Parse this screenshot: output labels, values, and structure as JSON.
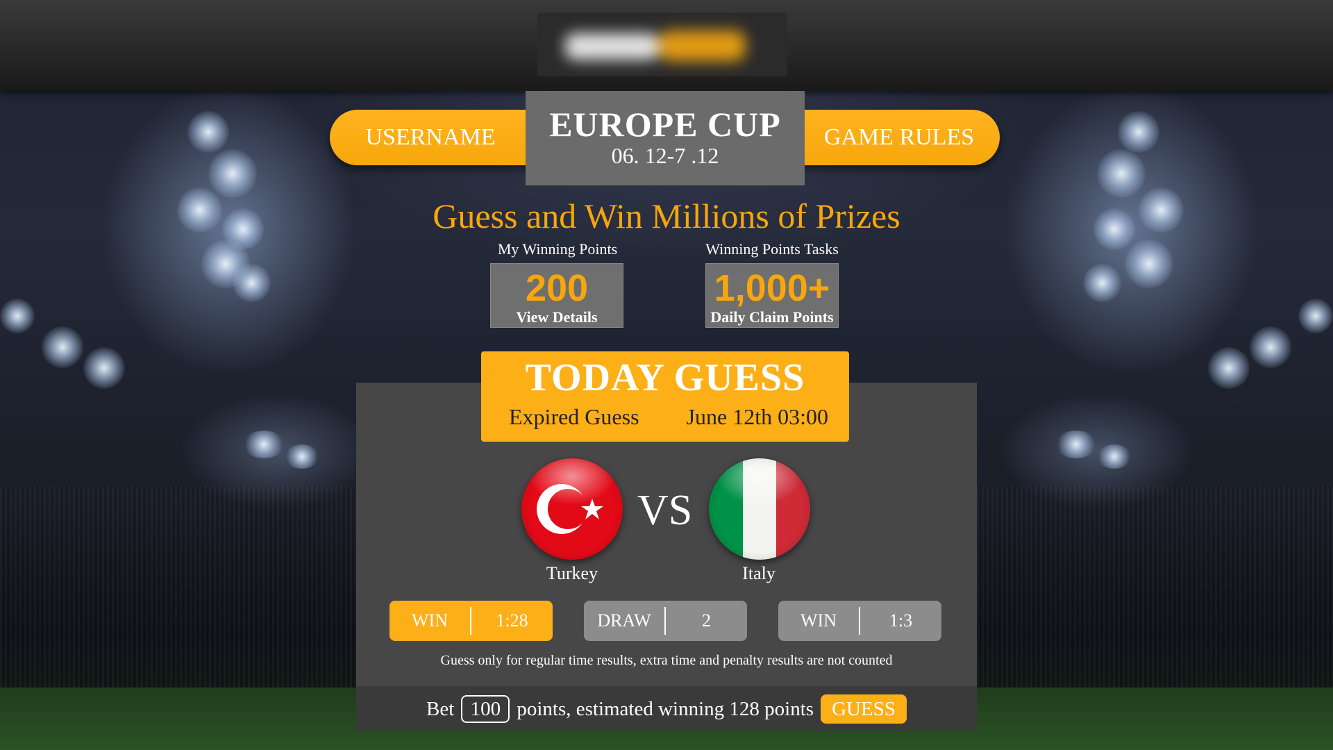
{
  "header": {
    "username_label": "USERNAME",
    "title": "EUROPE CUP",
    "dates": "06. 12-7 .12",
    "rules_label": "GAME RULES"
  },
  "headline": "Guess and Win Millions of Prizes",
  "points": {
    "my_label": "My Winning Points",
    "my_value": "200",
    "my_link": "View Details",
    "tasks_label": "Winning Points Tasks",
    "tasks_value": "1,000+",
    "tasks_link": "Daily Claim Points"
  },
  "today": {
    "title": "TODAY GUESS",
    "status": "Expired Guess",
    "time": "June 12th 03:00"
  },
  "match": {
    "home": "Turkey",
    "away": "Italy",
    "vs": "VS"
  },
  "odds": [
    {
      "label": "WIN",
      "value": "1:28",
      "state": "active"
    },
    {
      "label": "DRAW",
      "value": "2",
      "state": "inactive"
    },
    {
      "label": "WIN",
      "value": "1:3",
      "state": "inactive"
    }
  ],
  "note": "Guess only for regular time results, extra time and penalty results are not counted",
  "bet": {
    "prefix": "Bet",
    "amount": "100",
    "suffix": "points, estimated winning 128 points",
    "button": "GUESS"
  },
  "colors": {
    "accent": "#fdaf18",
    "panel": "#474747",
    "title_box": "#6b6b6b"
  }
}
